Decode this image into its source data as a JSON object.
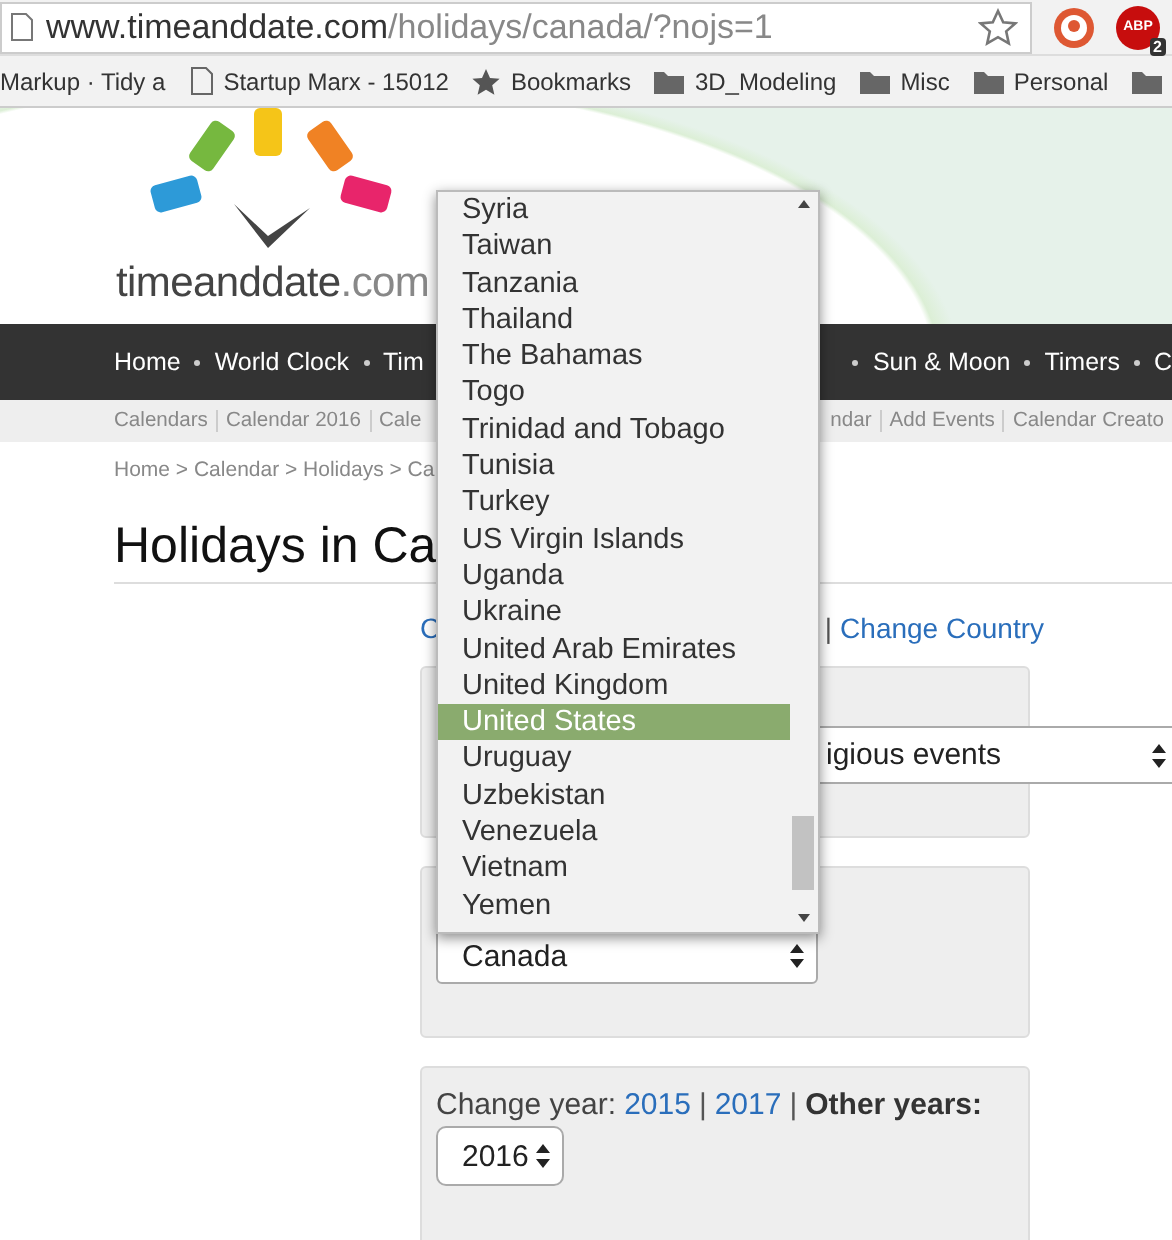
{
  "browser": {
    "url_host": "www.timeanddate.com",
    "url_path": "/holidays/canada/?nojs=1",
    "abp_label": "ABP",
    "abp_badge": "2",
    "bookmarks": [
      {
        "kind": "plain",
        "label": "Markup · Tidy a"
      },
      {
        "kind": "page",
        "label": "Startup Marx - 15012"
      },
      {
        "kind": "star",
        "label": "Bookmarks"
      },
      {
        "kind": "folder",
        "label": "3D_Modeling"
      },
      {
        "kind": "folder",
        "label": "Misc"
      },
      {
        "kind": "folder",
        "label": "Personal"
      },
      {
        "kind": "folder"
      }
    ]
  },
  "site": {
    "logo_name": "timeanddate",
    "logo_suffix": ".com",
    "nav_left": [
      "Home",
      "World Clock",
      "Tim"
    ],
    "nav_right": [
      "Sun & Moon",
      "Timers",
      "C"
    ],
    "subnav_left": [
      "Calendars",
      "Calendar 2016",
      "Cale"
    ],
    "subnav_right": [
      "ndar",
      "Add Events",
      "Calendar Creato"
    ],
    "breadcrumb": "Home > Calendar > Holidays > Ca",
    "title": "Holidays in Ca",
    "link_left": "C",
    "link_separator": "|",
    "link_right": "Change Country",
    "filter_select": "igious events",
    "country_select": "Canada",
    "year": {
      "label": "Change year:",
      "links": [
        "2015",
        "2017"
      ],
      "separator": "|",
      "other": "Other years:",
      "select": "2016"
    }
  },
  "dropdown": [
    {
      "label": "Syria",
      "selected": false
    },
    {
      "label": "Taiwan",
      "selected": false
    },
    {
      "label": "Tanzania",
      "selected": false
    },
    {
      "label": "Thailand",
      "selected": false
    },
    {
      "label": "The Bahamas",
      "selected": false
    },
    {
      "label": "Togo",
      "selected": false
    },
    {
      "label": "Trinidad and Tobago",
      "selected": false
    },
    {
      "label": "Tunisia",
      "selected": false
    },
    {
      "label": "Turkey",
      "selected": false
    },
    {
      "label": "US Virgin Islands",
      "selected": false
    },
    {
      "label": "Uganda",
      "selected": false
    },
    {
      "label": "Ukraine",
      "selected": false
    },
    {
      "label": "United Arab Emirates",
      "selected": false
    },
    {
      "label": "United Kingdom",
      "selected": false
    },
    {
      "label": "United States",
      "selected": true
    },
    {
      "label": "Uruguay",
      "selected": false
    },
    {
      "label": "Uzbekistan",
      "selected": false
    },
    {
      "label": "Venezuela",
      "selected": false
    },
    {
      "label": "Vietnam",
      "selected": false
    },
    {
      "label": "Yemen",
      "selected": false
    }
  ]
}
